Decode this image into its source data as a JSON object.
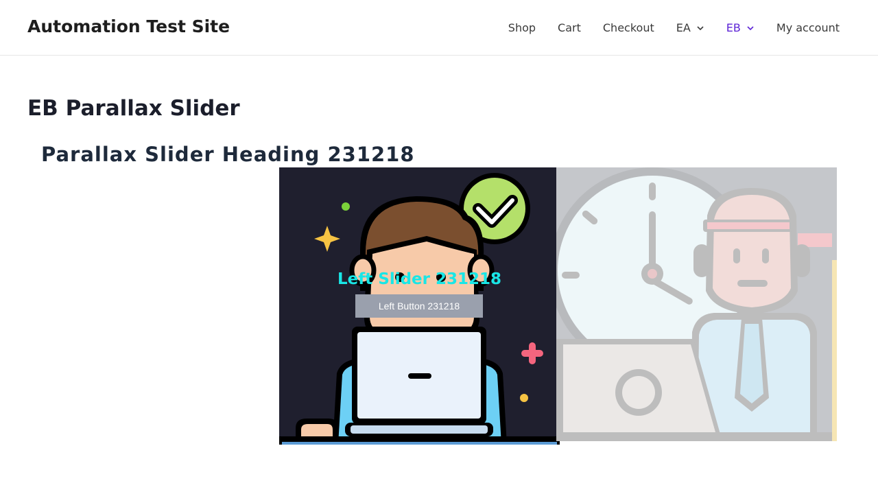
{
  "header": {
    "site_title": "Automation Test Site",
    "nav": [
      {
        "label": "Shop",
        "has_dropdown": false,
        "active": false
      },
      {
        "label": "Cart",
        "has_dropdown": false,
        "active": false
      },
      {
        "label": "Checkout",
        "has_dropdown": false,
        "active": false
      },
      {
        "label": "EA",
        "has_dropdown": true,
        "active": false
      },
      {
        "label": "EB",
        "has_dropdown": true,
        "active": true
      },
      {
        "label": "My account",
        "has_dropdown": false,
        "active": false
      }
    ],
    "active_color": "#5d24d6"
  },
  "page": {
    "title": "EB Parallax Slider",
    "slider_heading": "Parallax Slider Heading 231218"
  },
  "slider": {
    "left_slide": {
      "caption": "Left Slider 231218",
      "button_label": "Left Button 231218",
      "illustration": "person-with-laptop-checkmark-illustration",
      "caption_color": "#19e6e6"
    },
    "right_slide": {
      "illustration": "clock-and-office-worker-illustration"
    }
  }
}
